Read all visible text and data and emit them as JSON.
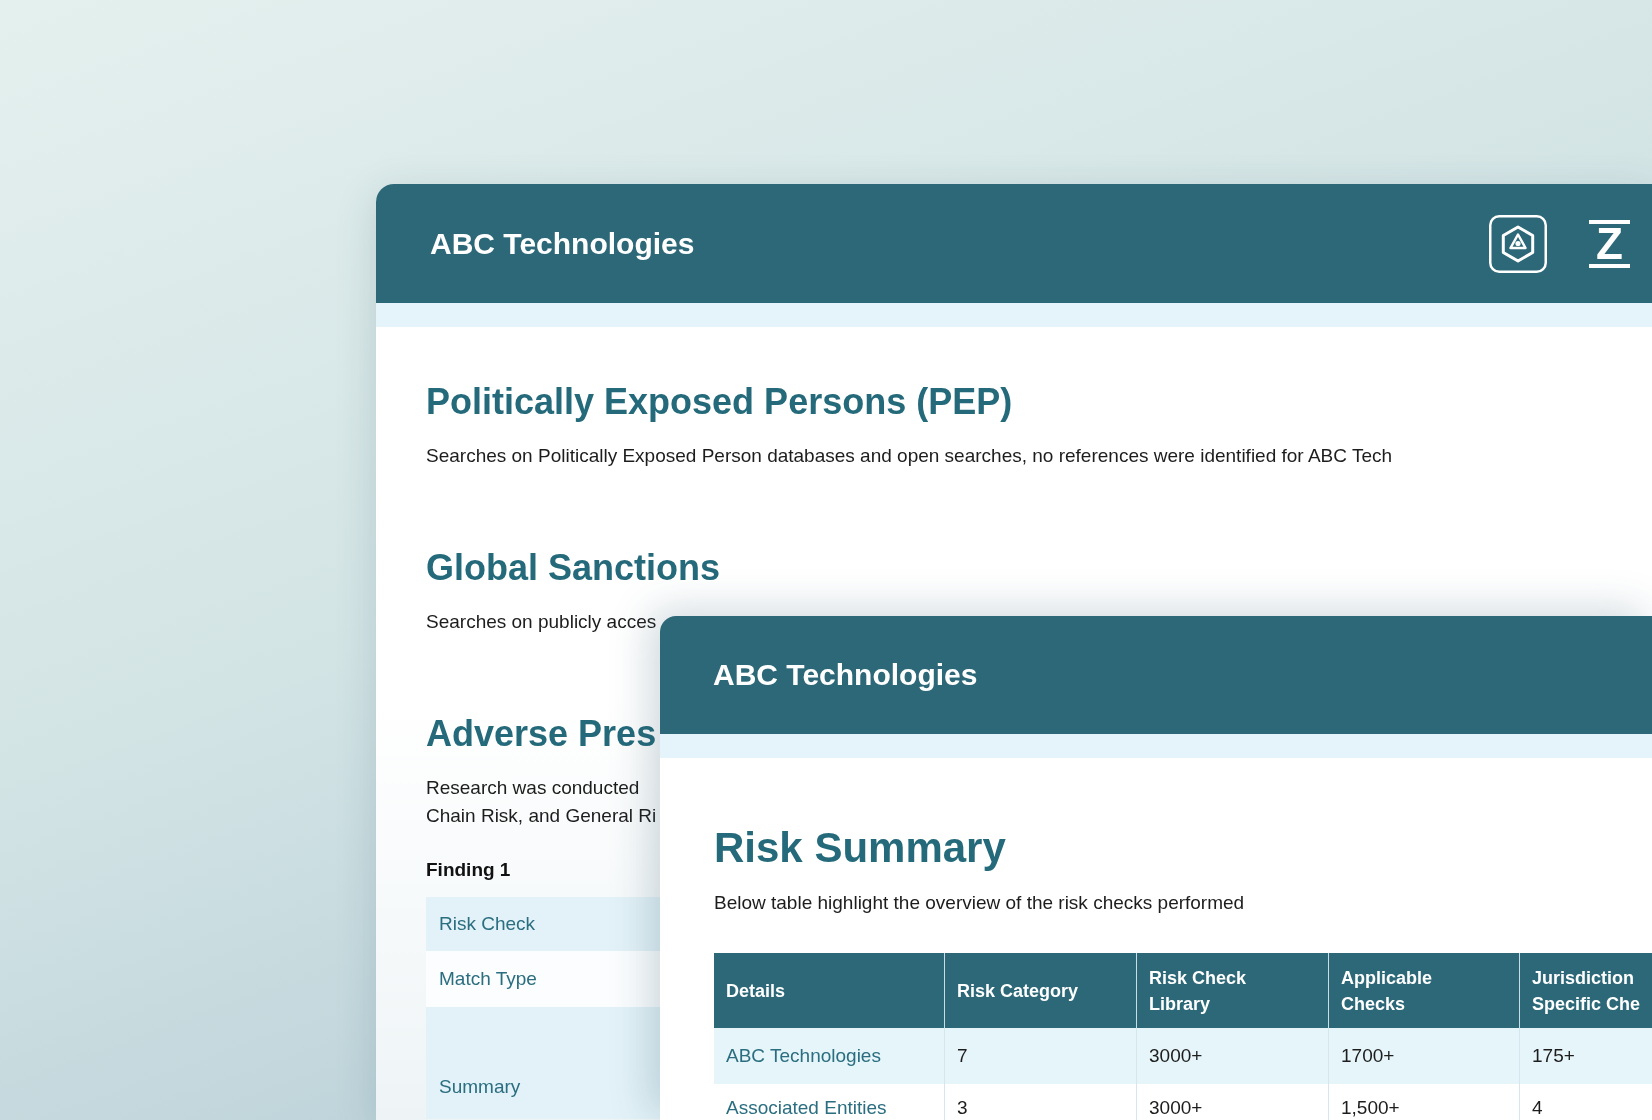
{
  "back_window": {
    "title": "ABC Technologies",
    "logo_text": "Z",
    "sections": [
      {
        "heading": "Politically Exposed Persons (PEP)",
        "lines": [
          "Searches on Politically Exposed Person databases and open searches, no references were identified for ABC Tech"
        ]
      },
      {
        "heading": "Global Sanctions",
        "lines": [
          "Searches on publicly acces"
        ]
      },
      {
        "heading": "Adverse Pres",
        "lines": [
          "Research was conducted",
          "Chain Risk, and General Ri"
        ]
      }
    ],
    "finding": {
      "title": "Finding 1",
      "rows": [
        "Risk Check",
        "Match Type",
        "Summary"
      ]
    }
  },
  "front_window": {
    "title": "ABC Technologies",
    "heading": "Risk Summary",
    "text": "Below table highlight the overview of the risk checks performed",
    "table": {
      "columns": [
        "Details",
        "Risk Category",
        "Risk Check Library",
        "Applicable Checks",
        "Jurisdiction Specific Che"
      ],
      "rows": [
        [
          "ABC Technologies",
          "7",
          "3000+",
          "1700+",
          "175+"
        ],
        [
          "Associated Entities",
          "3",
          "3000+",
          "1,500+",
          "4"
        ]
      ]
    }
  }
}
